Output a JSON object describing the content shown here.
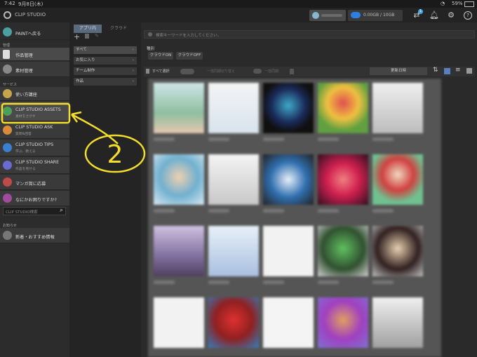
{
  "status": {
    "time": "7:42",
    "date": "9月8日(木)",
    "battery": "59%"
  },
  "header": {
    "app_title": "CLIP STUDIO",
    "storage": "0.00GB / 10GB",
    "notify_count": "1"
  },
  "sidebar": {
    "paint_back": "PAINTへ戻る",
    "section_manage": "管理",
    "works": "作品管理",
    "materials": "素材管理",
    "section_service": "サービス",
    "items": [
      {
        "label": "使い方講座",
        "sub": ""
      },
      {
        "label": "CLIP STUDIO ASSETS",
        "sub": "素材をさがす"
      },
      {
        "label": "CLIP STUDIO ASK",
        "sub": "質問&回答"
      },
      {
        "label": "CLIP STUDIO TIPS",
        "sub": "学ぶ、教える"
      },
      {
        "label": "CLIP STUDIO SHARE",
        "sub": "作品を見せる"
      },
      {
        "label": "マンガ賞に応募",
        "sub": ""
      },
      {
        "label": "なにかお困りですか?",
        "sub": ""
      }
    ],
    "search_placeholder": "CLIP STUDIO検索",
    "section_news": "お知らせ",
    "news": "新着・おすすめ情報"
  },
  "middle": {
    "tabs": [
      "アプリ内",
      "クラウド"
    ],
    "filters": [
      "すべて",
      "お気に入り",
      "チーム制作",
      "作品"
    ]
  },
  "main": {
    "search_placeholder": "検索キーワードを入力してください。",
    "type_label": "種別",
    "cloud_on": "クラウドON",
    "cloud_off": "クラウドOFF",
    "select_all": "すべて選択",
    "sort": "更新日時",
    "toolbar_actions": [
      "一括同期切り替え",
      "一括同期"
    ]
  },
  "annotation": {
    "number": "2"
  },
  "colors": {
    "accent": "#f3de2c",
    "cloud_blue": "#2d7fe0"
  }
}
